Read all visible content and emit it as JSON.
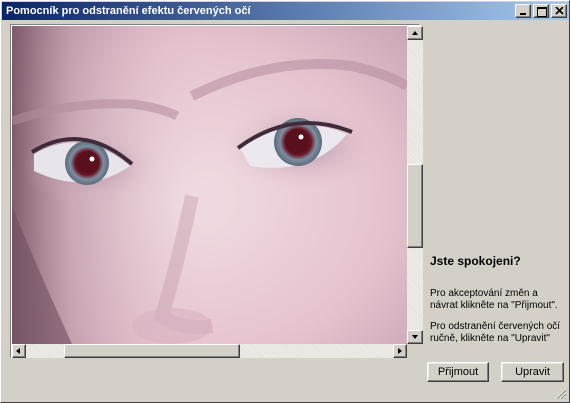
{
  "window": {
    "title": "Pomocník pro odstranění efektu červených očí"
  },
  "panel": {
    "question": "Jste spokojeni?",
    "accept_text": "Pro akceptování změn a návrat klikněte na \"Přijmout\".",
    "manual_text": "Pro odstranění červených očí ručně, klikněte na \"Upravit\""
  },
  "buttons": {
    "accept": "Přijmout",
    "edit": "Upravit"
  },
  "image": {
    "description_icon": "photo-eyes"
  },
  "colors": {
    "title_gradient_start": "#0a246a",
    "title_gradient_end": "#a6caf0",
    "face": "#ebcdd6",
    "pupil": "#5a0f1c"
  }
}
